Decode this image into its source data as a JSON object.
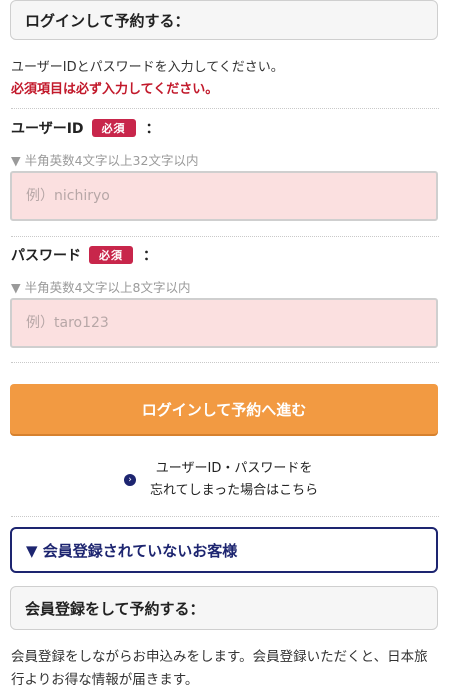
{
  "login_section": {
    "title": "ログインして予約する：",
    "description": "ユーザーIDとパスワードを入力してください。",
    "required_note": "必須項目は必ず入力してください。"
  },
  "user_id": {
    "label": "ユーザーID",
    "badge": "必須",
    "colon": "：",
    "hint": "▼ 半角英数4文字以上32文字以内",
    "placeholder": "例）nichiryo",
    "value": ""
  },
  "password": {
    "label": "パスワード",
    "badge": "必須",
    "colon": "：",
    "hint": "▼ 半角英数4文字以上8文字以内",
    "placeholder": "例）taro123",
    "value": ""
  },
  "login_button": {
    "label": "ログインして予約へ進む"
  },
  "forgot": {
    "icon": "chevron-right-circle-icon",
    "line1": "ユーザーID・パスワードを",
    "line2": "忘れてしまった場合はこちら"
  },
  "member": {
    "header": "▼ 会員登録されていないお客様",
    "register_title": "会員登録をして予約する：",
    "description": "会員登録をしながらお申込みをします。会員登録いただくと、日本旅行よりお得な情報が届きます。"
  },
  "colors": {
    "accent_orange": "#f29a42",
    "navy": "#1d2570",
    "required_red": "#c2192b",
    "input_bg": "#fbe0e0"
  }
}
